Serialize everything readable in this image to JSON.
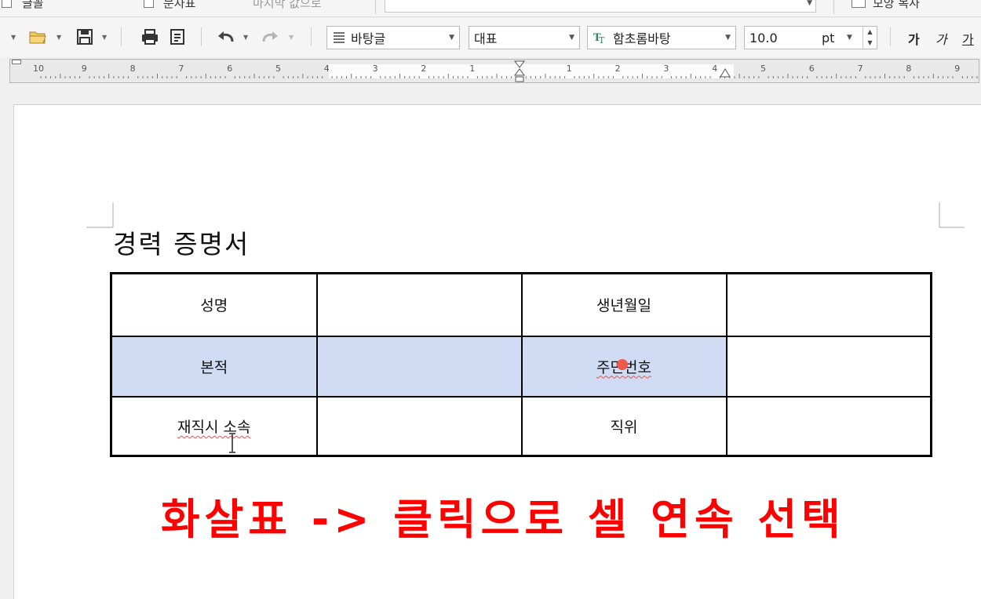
{
  "top_strip": {
    "item_1": "글꼴",
    "item_2": "문자표",
    "item_3": "마지막 값으로",
    "item_4": "모양 복사"
  },
  "toolbar": {
    "style_combo": "바탕글",
    "language_combo": "대표",
    "font_combo": "함초롬바탕",
    "font_size": "10.0",
    "font_unit": "pt",
    "bold_label": "가",
    "italic_label": "가",
    "underline_label": "가"
  },
  "ruler": {
    "left_numbers": [
      "10",
      "9",
      "8",
      "7",
      "6",
      "5",
      "4",
      "3",
      "2",
      "1"
    ],
    "right_numbers": [
      "1",
      "2",
      "3",
      "4",
      "5",
      "6",
      "7",
      "8",
      "9"
    ]
  },
  "document": {
    "title": "경력 증명서",
    "table": [
      [
        "성명",
        "",
        "생년월일",
        ""
      ],
      [
        "본적",
        "",
        "주민번호",
        ""
      ],
      [
        "재직시 소속",
        "",
        "직위",
        ""
      ]
    ]
  },
  "annotation": "화살표 -> 클릭으로 셀 연속 선택",
  "colors": {
    "selection": "#d0dbf4",
    "annotation": "#ff0000",
    "cursor_dot": "#f05a4a"
  }
}
